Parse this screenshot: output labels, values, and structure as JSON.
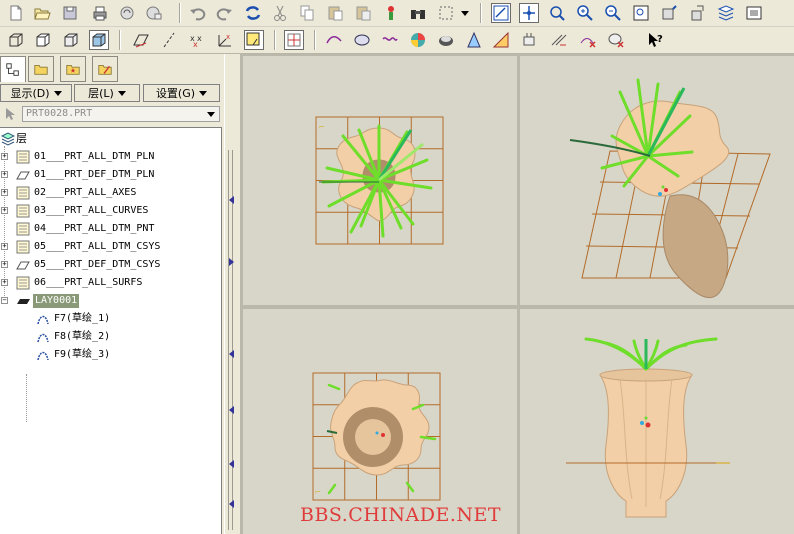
{
  "left_panel": {
    "menu_display": "显示(D)",
    "menu_layer": "层(L)",
    "menu_settings": "设置(G)",
    "path_value": "PRT0028.PRT",
    "tree_root": "层",
    "layers": [
      {
        "label": "01___PRT_ALL_DTM_PLN"
      },
      {
        "label": "01___PRT_DEF_DTM_PLN"
      },
      {
        "label": "02___PRT_ALL_AXES"
      },
      {
        "label": "03___PRT_ALL_CURVES"
      },
      {
        "label": "04___PRT_ALL_DTM_PNT"
      },
      {
        "label": "05___PRT_ALL_DTM_CSYS"
      },
      {
        "label": "05___PRT_DEF_DTM_CSYS"
      },
      {
        "label": "06___PRT_ALL_SURFS"
      },
      {
        "label": "LAY0001"
      }
    ],
    "children": [
      {
        "label": "F7(草绘_1)"
      },
      {
        "label": "F8(草绘_2)"
      },
      {
        "label": "F9(草绘_3)"
      }
    ]
  },
  "watermark": "BBS.CHINADE.NET",
  "colors": {
    "background": "#ece9d8",
    "viewport_bg": "#d8d6c8",
    "grid": "#b36b2a",
    "vase": "#f2cfa6",
    "leaves": "#6ede2a",
    "watermark": "#e03c3c",
    "selected_layer": "#8a9a78"
  },
  "toolbar_icons": [
    "new-icon",
    "open-icon",
    "save-icon",
    "print-icon",
    "email-icon",
    "undo-icon",
    "redo-icon",
    "regenerate-icon",
    "cut-icon",
    "copy-icon",
    "paste-icon",
    "paste-special-icon",
    "find-icon",
    "binoculars-icon",
    "select-box-icon",
    "plane-display-icon",
    "axis-display-icon",
    "point-display-icon",
    "zoom-in-icon",
    "zoom-out-icon",
    "refit-icon",
    "orient-icon",
    "named-views-icon",
    "layers-icon",
    "sketch-tool-icon"
  ]
}
